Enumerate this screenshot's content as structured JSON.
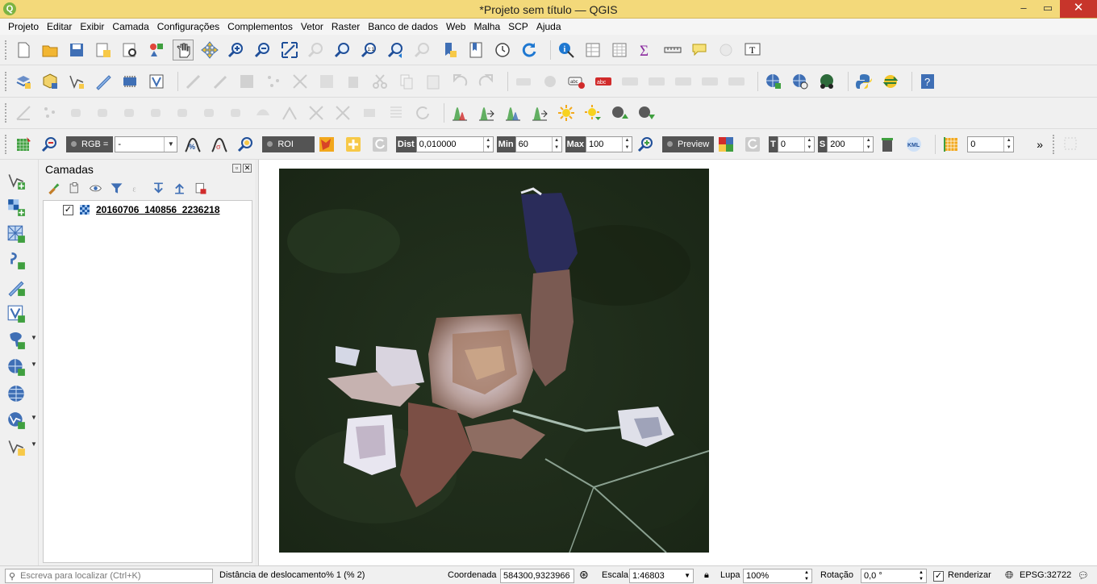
{
  "window": {
    "title": "*Projeto sem título — QGIS",
    "logo": "Q",
    "minimize": "–",
    "restore": "▭",
    "close": "✕"
  },
  "menu": [
    "Projeto",
    "Editar",
    "Exibir",
    "Camada",
    "Configurações",
    "Complementos",
    "Vetor",
    "Raster",
    "Banco de dados",
    "Web",
    "Malha",
    "SCP",
    "Ajuda"
  ],
  "scp_toolbar": {
    "rgb_label": "RGB =",
    "rgb_value": "-",
    "roi_label": "ROI",
    "dist_label": "Dist",
    "dist_value": "0,010000",
    "min_label": "Min",
    "min_value": "60",
    "max_label": "Max",
    "max_value": "100",
    "preview_label": "Preview",
    "t_label": "T",
    "t_value": "0",
    "s_label": "S",
    "s_value": "200",
    "kml_label": "KML",
    "band_value": "0",
    "more": "»"
  },
  "layers_panel": {
    "title": "Camadas",
    "layers": [
      {
        "name": "20160706_140856_2236218",
        "checked": "✓"
      }
    ]
  },
  "statusbar": {
    "search_placeholder": "Escreva para localizar (Ctrl+K)",
    "message": "Distância de deslocamento% 1 (% 2)",
    "coord_label": "Coordenada",
    "coord_value": "584300,9323966",
    "scale_label": "Escala",
    "scale_value": "1:46803",
    "magnifier_label": "Lupa",
    "magnifier_value": "100%",
    "rotation_label": "Rotação",
    "rotation_value": "0,0 °",
    "render_label": "Renderizar",
    "render_checked": "✓",
    "crs": "EPSG:32722"
  },
  "colors": {
    "titlebar": "#f3d97a",
    "scp_dark": "#545454",
    "accent_yellow": "#f7c948",
    "accent_blue": "#1f78d1"
  }
}
